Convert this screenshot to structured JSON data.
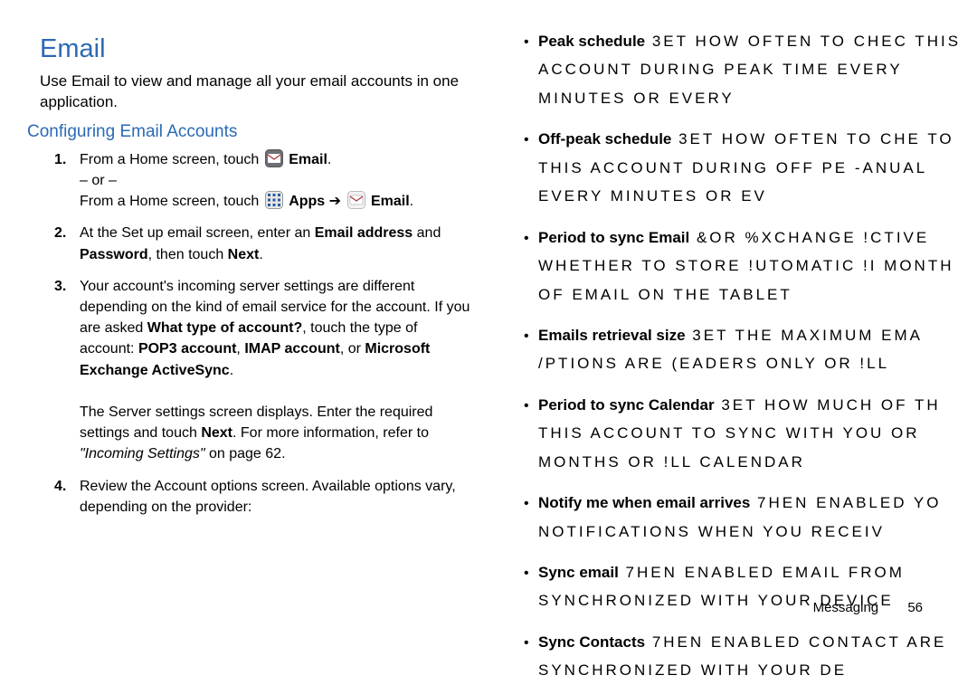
{
  "left": {
    "title": "Email",
    "intro": "Use Email to view and manage all your email accounts in one application.",
    "subtitle": "Configuring Email Accounts",
    "step1_a": "From a Home screen, touch ",
    "step1_email": "Email",
    "step1_or": "– or –",
    "step1_b": "From a Home screen, touch ",
    "step1_apps": "Apps",
    "step1_arrow": " ",
    "step1_email2": "Email",
    "step1_end": ".",
    "step2_a": "At the Set up email screen, enter an ",
    "step2_b": "Email address",
    "step2_c": " and ",
    "step2_d": "Password",
    "step2_e": ", then touch ",
    "step2_f": "Next",
    "step2_g": ".",
    "step3_a": "Your account's incoming server settings are different depending on the kind of email service for the account. If you are asked ",
    "step3_b": "What type of account?",
    "step3_c": ", touch the type of account: ",
    "step3_d": "POP3 account",
    "step3_e": ", ",
    "step3_f": "IMAP account",
    "step3_g": ", or ",
    "step3_h": "Microsoft Exchange ActiveSync",
    "step3_i": ".",
    "step3_j": "The Server settings screen displays. Enter the required settings and touch ",
    "step3_k": "Next",
    "step3_l": ". For more information, refer to ",
    "step3_m": "\"Incoming Settings\"",
    "step3_n": " on page 62.",
    "step4": "Review the Account options screen. Available options vary, depending on the provider:"
  },
  "right": {
    "items": [
      {
        "lead": "Peak schedule",
        "tail": "  3ET HOW OFTEN TO CHEC THIS ACCOUNT DURING PEAK TIME EVERY   MINUTES  OR EVERY"
      },
      {
        "lead": "Off-peak schedule",
        "tail": "  3ET HOW OFTEN TO CHE TO THIS ACCOUNT DURING OFF PE -ANUAL  EVERY   MINUTES  OR EV"
      },
      {
        "lead": "Period to sync Email",
        "tail": "  &OR %XCHANGE !CTIVE WHETHER TO STORE !UTOMATIC  !I MONTH OF EMAIL ON THE TABLET"
      },
      {
        "lead": "Emails retrieval size",
        "tail": "  3ET THE MAXIMUM EMA /PTIONS ARE  (EADERS ONLY   OR !LL"
      },
      {
        "lead": "Period to sync Calendar",
        "tail": "  3ET HOW MUCH OF TH THIS ACCOUNT TO SYNC WITH YOU  OR   MONTHS  OR !LL CALENDAR"
      },
      {
        "lead": "Notify me when email arrives",
        "tail": "  7HEN ENABLED  YO NOTIFICATIONS WHEN YOU RECEIV"
      },
      {
        "lead": "Sync email",
        "tail": "  7HEN ENABLED  EMAIL FROM SYNCHRONIZED WITH YOUR DEVICE"
      },
      {
        "lead": "Sync Contacts",
        "tail": "  7HEN ENABLED  CONTACT ARE SYNCHRONIZED WITH YOUR DE"
      }
    ]
  },
  "footer": {
    "section": "Messaging",
    "page": "56"
  }
}
